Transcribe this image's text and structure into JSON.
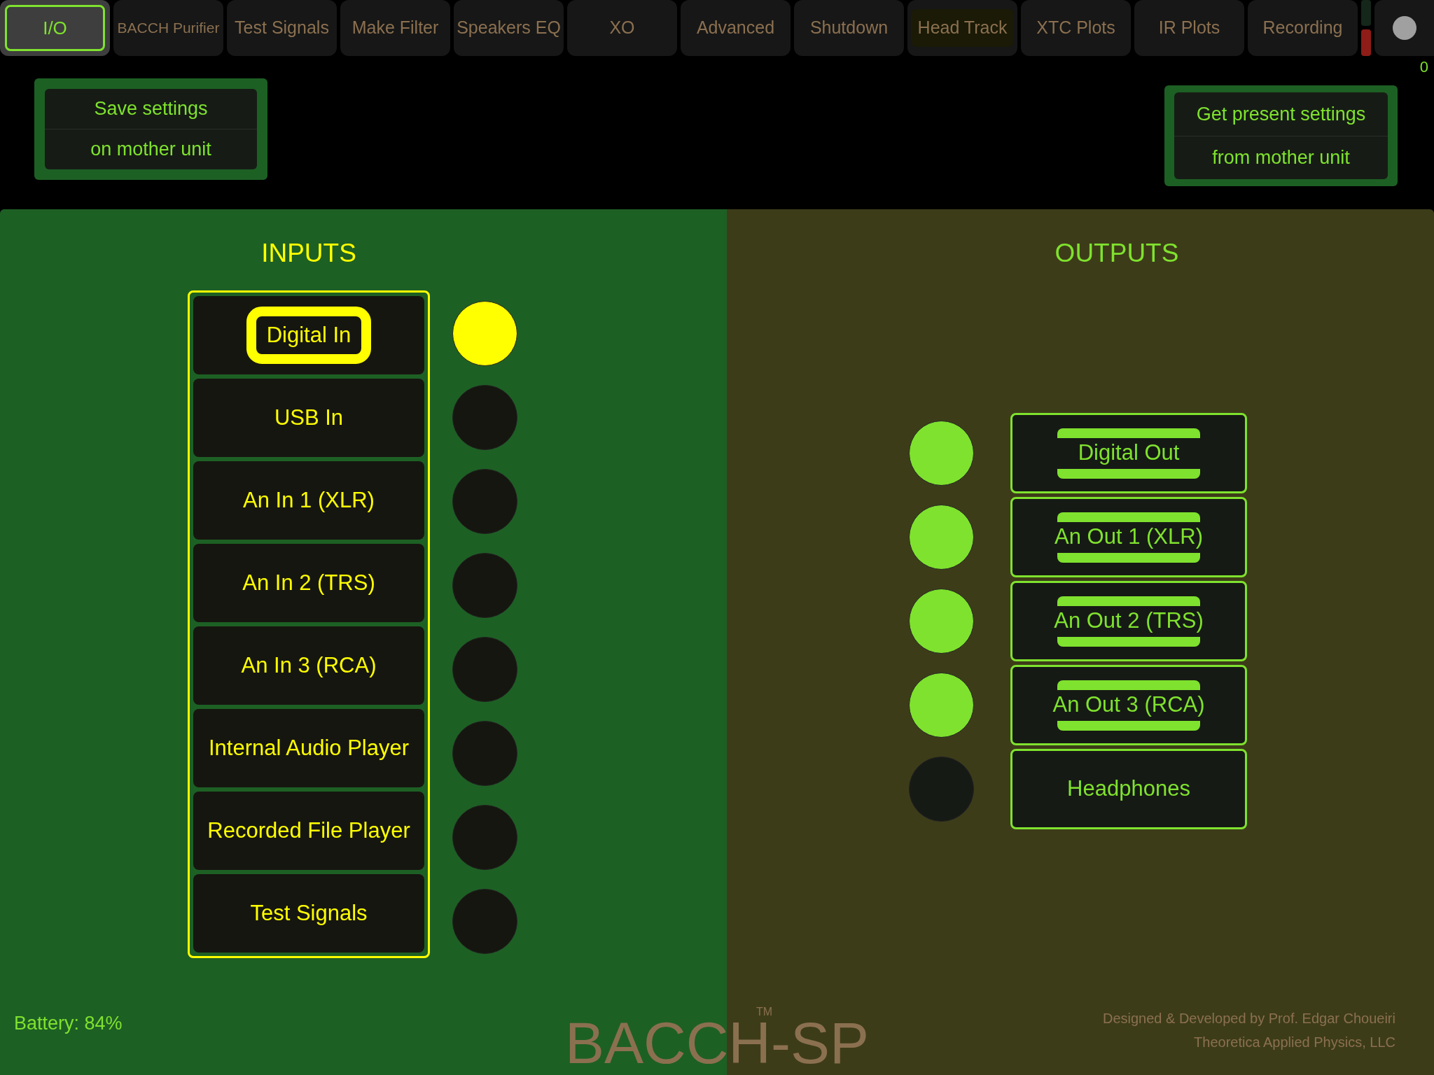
{
  "tabs": [
    {
      "label": "I/O",
      "selected": true,
      "highlighted": false
    },
    {
      "label": "BACCH Purifier",
      "selected": false,
      "highlighted": false
    },
    {
      "label": "Test Signals",
      "selected": false,
      "highlighted": false
    },
    {
      "label": "Make Filter",
      "selected": false,
      "highlighted": false
    },
    {
      "label": "Speakers EQ",
      "selected": false,
      "highlighted": false
    },
    {
      "label": "XO",
      "selected": false,
      "highlighted": false
    },
    {
      "label": "Advanced",
      "selected": false,
      "highlighted": false
    },
    {
      "label": "Shutdown",
      "selected": false,
      "highlighted": false
    },
    {
      "label": "Head Track",
      "selected": false,
      "highlighted": true
    },
    {
      "label": "XTC Plots",
      "selected": false,
      "highlighted": false
    },
    {
      "label": "IR Plots",
      "selected": false,
      "highlighted": false
    },
    {
      "label": "Recording",
      "selected": false,
      "highlighted": false
    }
  ],
  "counter": "0",
  "save_button": {
    "lines": [
      "Save settings",
      "on mother unit"
    ]
  },
  "get_button": {
    "lines": [
      "Get present settings",
      "from mother unit"
    ]
  },
  "inputs": {
    "title": "INPUTS",
    "items": [
      {
        "label": "Digital In",
        "selected": true
      },
      {
        "label": "USB In",
        "selected": false
      },
      {
        "label": "An In 1 (XLR)",
        "selected": false
      },
      {
        "label": "An In 2 (TRS)",
        "selected": false
      },
      {
        "label": "An In 3 (RCA)",
        "selected": false
      },
      {
        "label": "Internal Audio Player",
        "selected": false
      },
      {
        "label": "Recorded File Player",
        "selected": false
      },
      {
        "label": "Test Signals",
        "selected": false
      }
    ]
  },
  "outputs": {
    "title": "OUTPUTS",
    "items": [
      {
        "label": "Digital Out",
        "on": true
      },
      {
        "label": "An Out 1 (XLR)",
        "on": true
      },
      {
        "label": "An Out 2 (TRS)",
        "on": true
      },
      {
        "label": "An Out 3 (RCA)",
        "on": true
      },
      {
        "label": "Headphones",
        "on": false
      }
    ]
  },
  "battery": "Battery: 84%",
  "logo": {
    "name": "BACCH-SP",
    "mark": "TM"
  },
  "credits": [
    "Designed & Developed by Prof. Edgar Choueiri",
    "Theoretica Applied Physics, LLC"
  ]
}
